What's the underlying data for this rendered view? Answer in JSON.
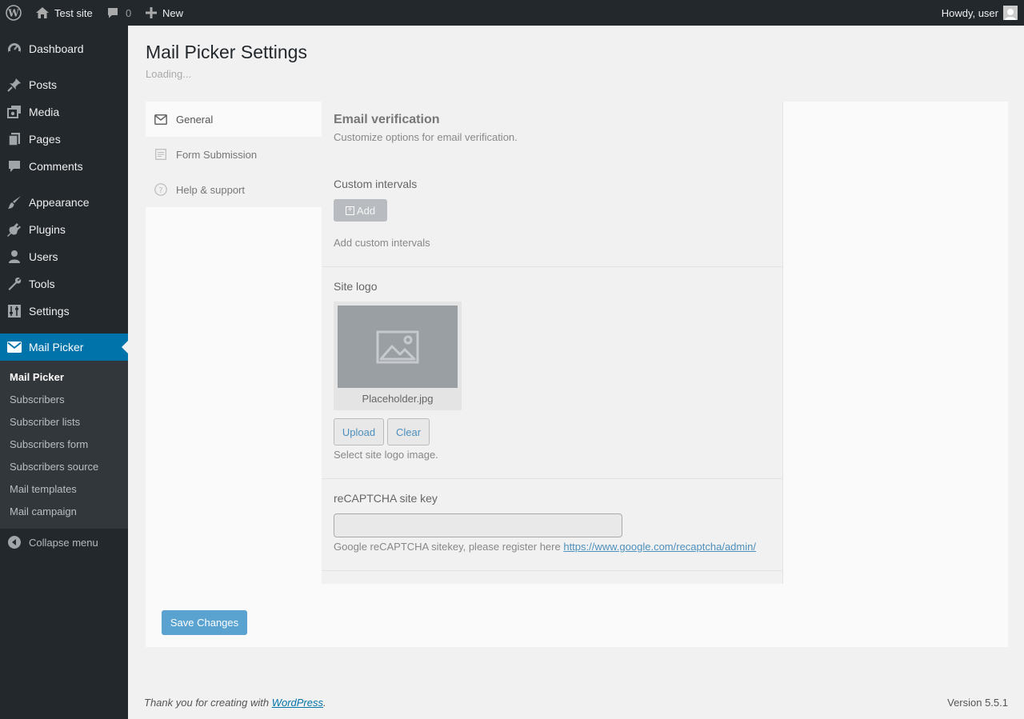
{
  "adminbar": {
    "site_name": "Test site",
    "comments_count": "0",
    "new_label": "New",
    "howdy": "Howdy, user"
  },
  "sidebar": {
    "items": [
      {
        "label": "Dashboard",
        "icon": "dashboard-icon"
      },
      {
        "label": "Posts",
        "icon": "pin-icon"
      },
      {
        "label": "Media",
        "icon": "media-icon"
      },
      {
        "label": "Pages",
        "icon": "pages-icon"
      },
      {
        "label": "Comments",
        "icon": "comment-icon"
      },
      {
        "label": "Appearance",
        "icon": "brush-icon"
      },
      {
        "label": "Plugins",
        "icon": "plug-icon"
      },
      {
        "label": "Users",
        "icon": "user-icon"
      },
      {
        "label": "Tools",
        "icon": "wrench-icon"
      },
      {
        "label": "Settings",
        "icon": "settings-icon"
      },
      {
        "label": "Mail Picker",
        "icon": "envelope-icon"
      }
    ],
    "submenu": [
      "Mail Picker",
      "Subscribers",
      "Subscriber lists",
      "Subscribers form",
      "Subscribers source",
      "Mail templates",
      "Mail campaign"
    ],
    "collapse": "Collapse menu"
  },
  "main": {
    "title": "Mail Picker Settings",
    "loading": "Loading...",
    "tabs": [
      {
        "label": "General",
        "icon": "envelope-outline-icon"
      },
      {
        "label": "Form Submission",
        "icon": "form-icon"
      },
      {
        "label": "Help & support",
        "icon": "question-icon"
      }
    ],
    "section_title": "Email verification",
    "section_desc": "Customize options for email verification.",
    "custom_intervals": {
      "label": "Custom intervals",
      "add_button": "Add",
      "help": "Add custom intervals"
    },
    "site_logo": {
      "label": "Site logo",
      "file_name": "Placeholder.jpg",
      "upload": "Upload",
      "clear": "Clear",
      "help": "Select site logo image."
    },
    "recaptcha": {
      "label": "reCAPTCHA site key",
      "value": "",
      "help_text": "Google reCAPTCHA sitekey, please register here ",
      "link": "https://www.google.com/recaptcha/admin/"
    },
    "save_label": "Save Changes"
  },
  "footer": {
    "thanks_prefix": "Thank you for creating with ",
    "thanks_link": "WordPress",
    "thanks_suffix": ".",
    "version": "Version 5.5.1"
  },
  "colors": {
    "adminbar": "#23282d",
    "accent": "#0073aa",
    "button": "#5aa3d1"
  }
}
